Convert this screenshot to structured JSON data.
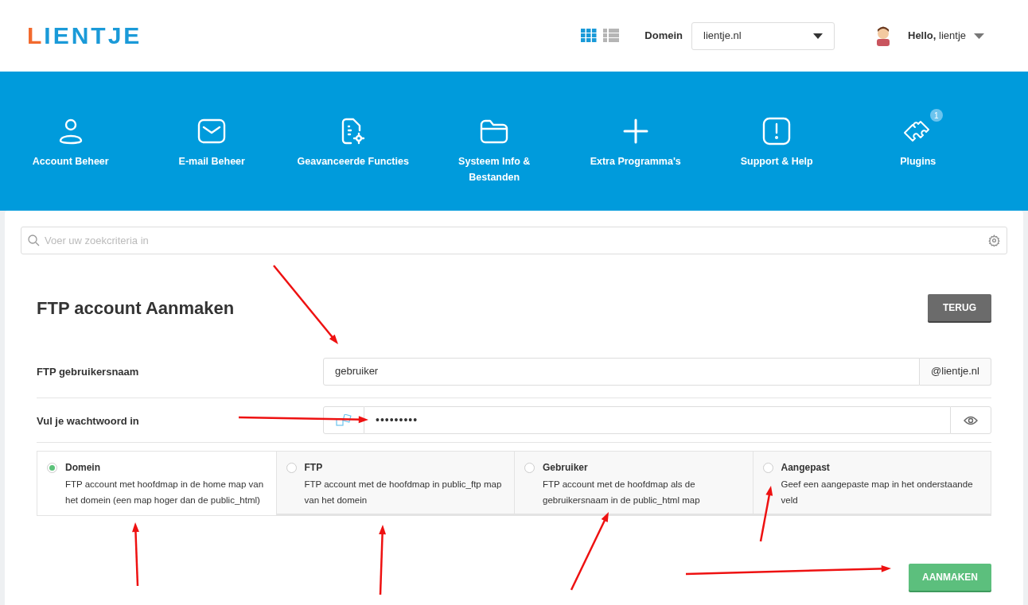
{
  "header": {
    "logo_first": "L",
    "logo_rest": "IENTJE",
    "view_modes": [
      {
        "kind": "grid",
        "selected": true
      },
      {
        "kind": "list",
        "selected": false
      }
    ],
    "domain_label": "Domein",
    "domain_value": "lientje.nl",
    "greeting_bold": "Hello,",
    "user": "lientje"
  },
  "nav": [
    {
      "kind": "user",
      "label": "Account Beheer"
    },
    {
      "kind": "mail",
      "label": "E-mail Beheer"
    },
    {
      "kind": "doc",
      "label": "Geavanceerde Functies"
    },
    {
      "kind": "folder",
      "label": "Systeem Info & Bestanden"
    },
    {
      "kind": "plus",
      "label": "Extra Programma's"
    },
    {
      "kind": "alert",
      "label": "Support & Help"
    },
    {
      "kind": "puzzle",
      "label": "Plugins",
      "badge": "1"
    }
  ],
  "search": {
    "placeholder": "Voer uw zoekcriteria in"
  },
  "form": {
    "title": "FTP account Aanmaken",
    "back_button": "TERUG",
    "username": {
      "label": "FTP gebruikersnaam",
      "value": "gebruiker",
      "suffix": "@lientje.nl"
    },
    "password": {
      "label": "Vul je wachtwoord in",
      "value": "•••••••••"
    },
    "options": [
      {
        "title": "Domein",
        "description": "FTP account met hoofdmap in de home map van het domein (een map hoger dan de public_html)",
        "selected": true
      },
      {
        "title": "FTP",
        "description": "FTP account met de hoofdmap in public_ftp map van het domein",
        "selected": false
      },
      {
        "title": "Gebruiker",
        "description": "FTP account met de hoofdmap als de gebruikersnaam in de public_html map",
        "selected": false
      },
      {
        "title": "Aangepast",
        "description": "Geef een aangepaste map in het onderstaande veld",
        "selected": false
      }
    ],
    "submit_button": "AANMAKEN"
  }
}
